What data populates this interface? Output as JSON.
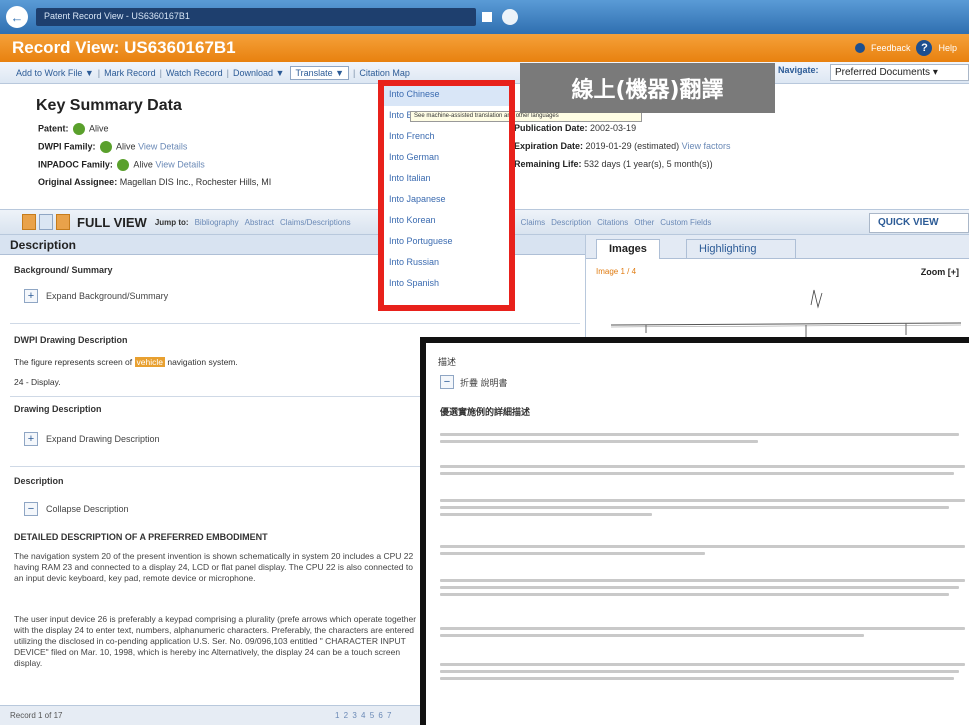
{
  "window": {
    "address": "Patent Record View - US6360167B1"
  },
  "record": {
    "title": "Record View: US6360167B1",
    "feedback": "Feedback",
    "help": "Help"
  },
  "actions": {
    "add_to_work_file": "Add to Work File ▼",
    "mark_record": "Mark Record",
    "watch_record": "Watch Record",
    "download": "Download ▼",
    "translate": "Translate ▼",
    "citation_map": "Citation Map",
    "navigate_label": "Navigate:",
    "navigate_value": "Preferred Documents ▾"
  },
  "summary": {
    "heading": "Key Summary Data",
    "patent_label": "Patent:",
    "patent_value": "Alive",
    "dwpi_label": "DWPI Family:",
    "dwpi_value": "Alive",
    "dwpi_link": "View Details",
    "inpadoc_label": "INPADOC Family:",
    "inpadoc_value": "Alive",
    "inpadoc_link": "View Details",
    "assignee_label": "Original Assignee:",
    "assignee_value": "Magellan DIS Inc., Rochester Hills, MI",
    "pub_label": "Publication Date:",
    "pub_value": "2002-03-19",
    "exp_label": "Expiration Date:",
    "exp_value": "2019-01-29 (estimated)",
    "exp_link": "View factors",
    "life_label": "Remaining Life:",
    "life_value": "532 days (1 year(s), 5 month(s))"
  },
  "fullview": {
    "title": "FULL VIEW",
    "jump_to": "Jump to:",
    "links": [
      "Bibliography",
      "Abstract",
      "Claims/Descriptions",
      "Claims",
      "Description",
      "Citations",
      "Other",
      "Custom Fields"
    ],
    "quick_view": "QUICK VIEW"
  },
  "description": {
    "heading": "Description",
    "background_title": "Background/ Summary",
    "expand_background": "Expand Background/Summary",
    "dwpi_drawing_title": "DWPI Drawing Description",
    "dwpi_drawing_text_pre": "The figure represents screen of",
    "dwpi_drawing_highlight": "vehicle",
    "dwpi_drawing_text_post": "navigation system.",
    "dwpi_drawing_item": "24 - Display.",
    "drawing_desc_title": "Drawing Description",
    "expand_drawing": "Expand Drawing Description",
    "desc_title": "Description",
    "collapse_desc": "Collapse Description",
    "detailed_title": "DETAILED DESCRIPTION OF A PREFERRED EMBODIMENT",
    "para1": "The navigation system 20 of the present invention is shown schematically in system 20 includes a CPU 22 having RAM 23 and connected to a display 24, LCD or flat panel display. The CPU 22 is also connected to an input devic keyboard, key pad, remote device or microphone.",
    "para2": "The user input device 26 is preferably a keypad comprising a plurality (prefe arrows which operate together with the display 24 to enter text, numbers, alphanumeric characters. Preferably, the characters are entered utilizing the disclosed in co-pending application U.S. Ser. No. 09/096,103 entitled \" CHARACTER INPUT DEVICE\" filed on Mar. 10, 1998, which is hereby inc Alternatively, the display 24 can be a touch screen display."
  },
  "footer": {
    "record": "Record 1 of 17",
    "pages": "1 2 3 4 5 6 7"
  },
  "images": {
    "tab_images": "Images",
    "tab_highlighting": "Highlighting",
    "count": "Image 1 / 4",
    "zoom": "Zoom [+]"
  },
  "translate_menu": {
    "options": [
      "Into Chinese",
      "Into English",
      "Into French",
      "Into German",
      "Into Italian",
      "Into Japanese",
      "Into Korean",
      "Into Portuguese",
      "Into Russian",
      "Into Spanish"
    ],
    "tooltip": "See machine-assisted translation and other languages"
  },
  "callout": "線上(機器)翻譯",
  "overlay": {
    "heading": "描述",
    "collapse": "折疊 說明書",
    "title": "優選實施例的詳細描述"
  },
  "colors": {
    "accent_orange": "#e8810f",
    "header_blue": "#2f6fb0",
    "highlight_red": "#e8211b"
  }
}
